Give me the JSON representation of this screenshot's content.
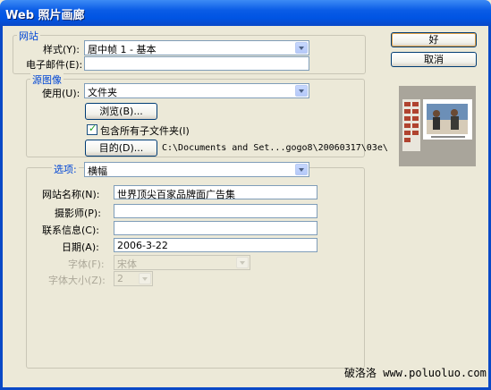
{
  "window": {
    "title": "Web 照片画廊"
  },
  "site_group": {
    "legend": "网站",
    "style_label": "样式(Y):",
    "style_value": "居中帧 1 - 基本",
    "email_label": "电子邮件(E):",
    "email_value": ""
  },
  "source_group": {
    "legend": "源图像",
    "use_label": "使用(U):",
    "use_value": "文件夹",
    "browse_button": "浏览(B)...",
    "include_subfolders": "包含所有子文件夹(I)",
    "include_subfolders_checked": true,
    "destination_button": "目的(D)...",
    "destination_path": "C:\\Documents and Set...gogo8\\20060317\\03e\\"
  },
  "options_group": {
    "legend": "选项:",
    "option_value": "横幅",
    "site_name_label": "网站名称(N):",
    "site_name_value": "世界顶尖百家品牌面广告集",
    "photographer_label": "摄影师(P):",
    "photographer_value": "",
    "contact_label": "联系信息(C):",
    "contact_value": "",
    "date_label": "日期(A):",
    "date_value": "2006-3-22",
    "font_label": "字体(F):",
    "font_value": "宋体",
    "font_size_label": "字体大小(Z):",
    "font_size_value": "2"
  },
  "buttons": {
    "ok": "好",
    "cancel": "取消"
  },
  "watermark": "破洛洛 www.poluoluo.com",
  "colors": {
    "title_bar": "#0054e3",
    "dialog_bg": "#ece9d8",
    "legend_text": "#0046d5"
  }
}
